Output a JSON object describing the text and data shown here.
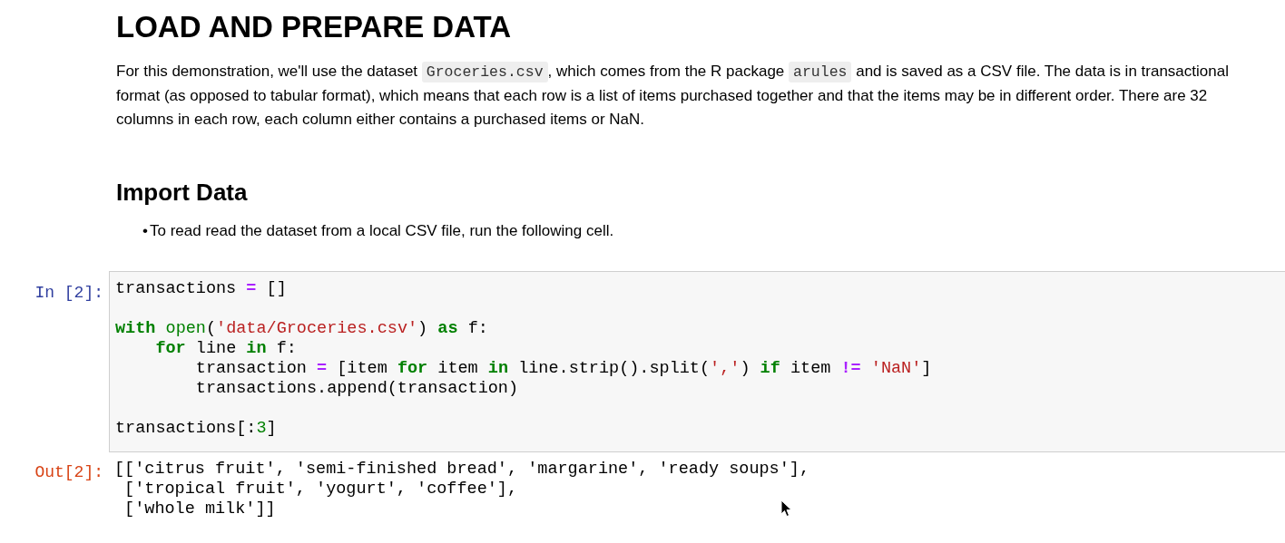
{
  "heading": "LOAD AND PREPARE DATA",
  "intro": [
    {
      "kind": "text",
      "text": "For this demonstration, we'll use the dataset "
    },
    {
      "kind": "code",
      "text": "Groceries.csv"
    },
    {
      "kind": "text",
      "text": ", which comes from the R package "
    },
    {
      "kind": "code",
      "text": "arules"
    },
    {
      "kind": "text",
      "text": " and is saved as a CSV file. The data is in transactional format (as opposed to tabular format), which means that each row is a list of items purchased together and that the items may be in different order. There are 32 columns in each row, each column either contains a purchased items or NaN."
    }
  ],
  "subheading": "Import Data",
  "bullets": [
    {
      "marker": "•",
      "text": "To read read the dataset from a local CSV file, run the following cell."
    }
  ],
  "input_cell": {
    "prompt": "In [2]:",
    "lines": [
      {
        "kind": "code",
        "tokens": [
          {
            "kind": "plain",
            "t": "transactions "
          },
          {
            "kind": "op",
            "t": "="
          },
          {
            "kind": "plain",
            "t": " []"
          }
        ]
      },
      {
        "kind": "blank"
      },
      {
        "kind": "code",
        "tokens": [
          {
            "kind": "kw",
            "t": "with"
          },
          {
            "kind": "builtin",
            "t": " open"
          },
          {
            "kind": "plain",
            "t": "("
          },
          {
            "kind": "str",
            "t": "'data/Groceries.csv'"
          },
          {
            "kind": "plain",
            "t": ") "
          },
          {
            "kind": "kw",
            "t": "as"
          },
          {
            "kind": "plain",
            "t": " f:"
          }
        ],
        "children": [
          {
            "kind": "code",
            "tokens": [
              {
                "kind": "kw",
                "t": "for"
              },
              {
                "kind": "plain",
                "t": " line "
              },
              {
                "kind": "kw",
                "t": "in"
              },
              {
                "kind": "plain",
                "t": " f:"
              }
            ],
            "children": [
              {
                "kind": "code",
                "tokens": [
                  {
                    "kind": "plain",
                    "t": "transaction "
                  },
                  {
                    "kind": "op",
                    "t": "="
                  },
                  {
                    "kind": "plain",
                    "t": " [item "
                  },
                  {
                    "kind": "kw",
                    "t": "for"
                  },
                  {
                    "kind": "plain",
                    "t": " item "
                  },
                  {
                    "kind": "kw",
                    "t": "in"
                  },
                  {
                    "kind": "plain",
                    "t": " line.strip().split("
                  },
                  {
                    "kind": "str",
                    "t": "','"
                  },
                  {
                    "kind": "plain",
                    "t": ") "
                  },
                  {
                    "kind": "kw",
                    "t": "if"
                  },
                  {
                    "kind": "plain",
                    "t": " item "
                  },
                  {
                    "kind": "op",
                    "t": "!="
                  },
                  {
                    "kind": "str",
                    "t": " 'NaN'"
                  },
                  {
                    "kind": "plain",
                    "t": "]"
                  }
                ]
              },
              {
                "kind": "code",
                "tokens": [
                  {
                    "kind": "plain",
                    "t": "transactions.append(transaction)"
                  }
                ]
              }
            ]
          }
        ]
      },
      {
        "kind": "blank"
      },
      {
        "kind": "code",
        "tokens": [
          {
            "kind": "plain",
            "t": "transactions[:"
          },
          {
            "kind": "num",
            "t": "3"
          },
          {
            "kind": "plain",
            "t": "]"
          }
        ]
      }
    ]
  },
  "output_cell": {
    "prompt": "Out[2]:",
    "lines": [
      "[['citrus fruit', 'semi-finished bread', 'margarine', 'ready soups'],",
      " ['tropical fruit', 'yogurt', 'coffee'],",
      " ['whole milk']]"
    ]
  }
}
